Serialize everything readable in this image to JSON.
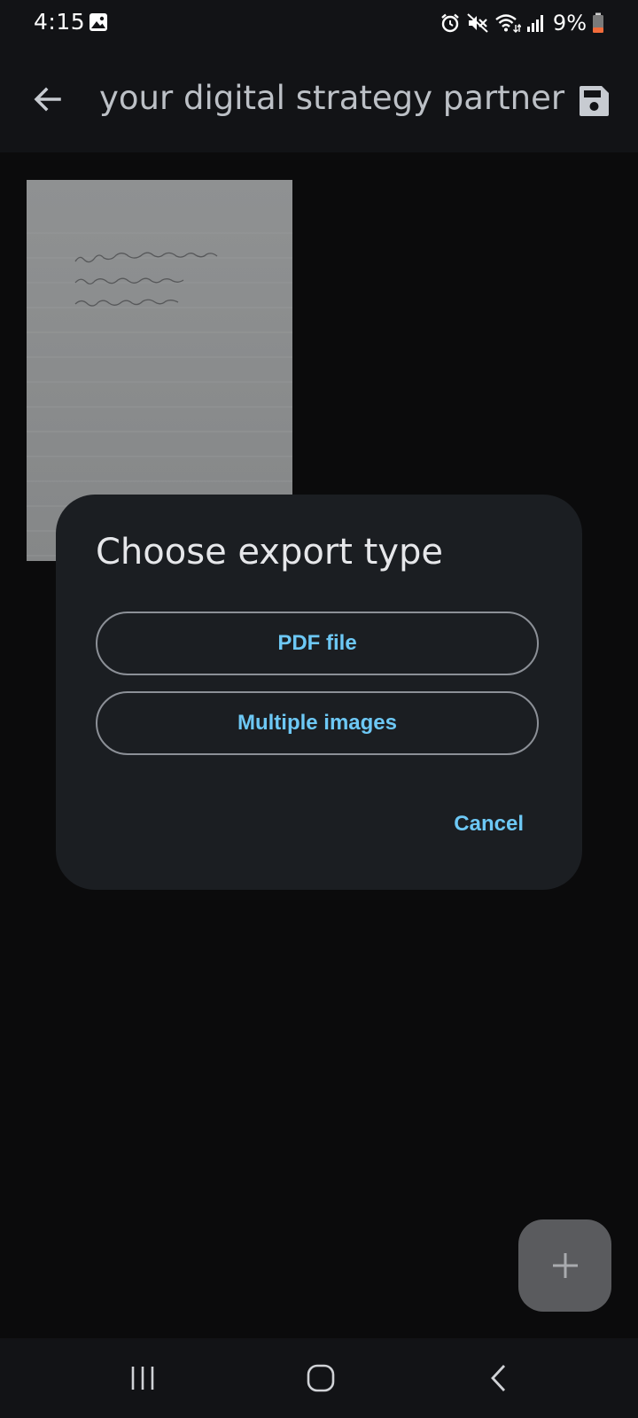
{
  "status_bar": {
    "time": "4:15",
    "battery": "9%",
    "icons": [
      "gallery-icon",
      "alarm-icon",
      "mute-icon",
      "wifi-icon",
      "signal-icon",
      "battery-icon"
    ]
  },
  "app_bar": {
    "title": "your digital strategy partner",
    "back_icon": "arrow-back-icon",
    "save_icon": "save-icon"
  },
  "page_thumbnail": {
    "handwritten_text": "Hello there! This is a test page! The file scanner on Notesbeat is very powerful!"
  },
  "dialog": {
    "title": "Choose export type",
    "options": [
      {
        "label": "PDF file"
      },
      {
        "label": "Multiple images"
      }
    ],
    "cancel_label": "Cancel"
  },
  "fab": {
    "icon": "plus-icon"
  },
  "nav_bar": {
    "icons": [
      "recents-icon",
      "home-icon",
      "back-icon"
    ]
  },
  "colors": {
    "accent": "#6dc8f5",
    "dialog_bg": "#1b1e22",
    "bar_bg": "#121316",
    "screen_bg": "#0b0b0c",
    "battery_low": "#f26b3a"
  }
}
